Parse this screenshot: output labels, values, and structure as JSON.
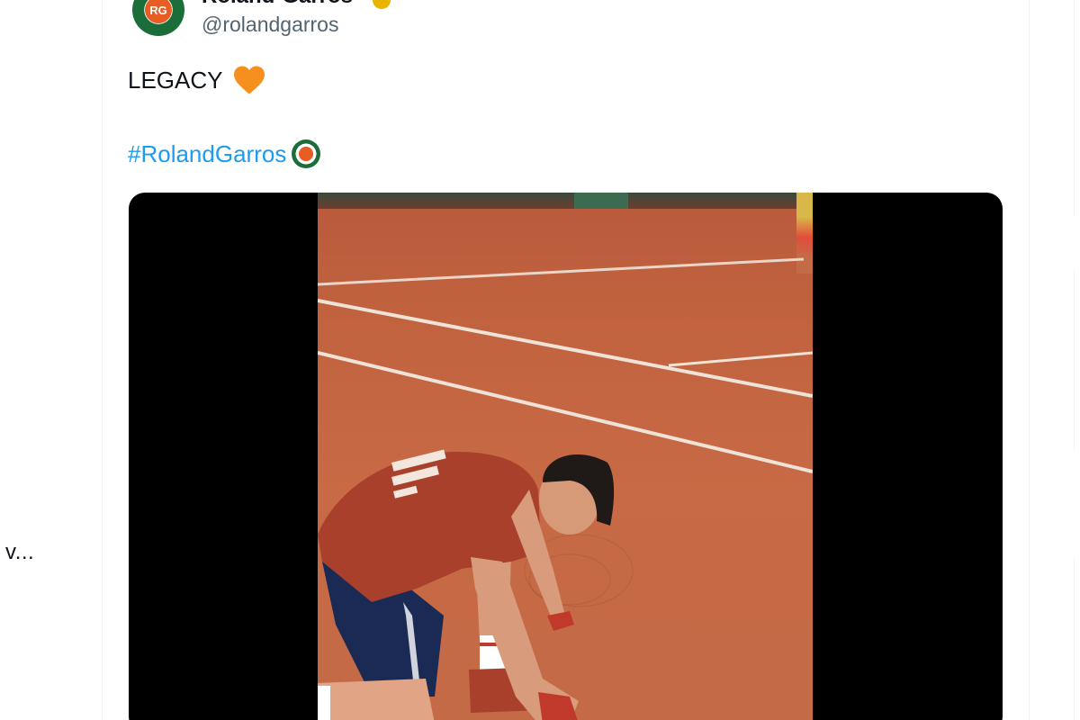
{
  "tweet": {
    "display_name": "Roland-Garros",
    "handle": "@rolandgarros",
    "text": "LEGACY",
    "hashtag": "#RolandGarros",
    "avatar_text": "RG"
  },
  "sidebar": {
    "truncated_text": "v..."
  },
  "colors": {
    "link": "#1d9bf0",
    "heart": "#f5901e",
    "clay": "#c46a47",
    "shirt": "#a8402c",
    "shorts": "#1a2a55"
  }
}
